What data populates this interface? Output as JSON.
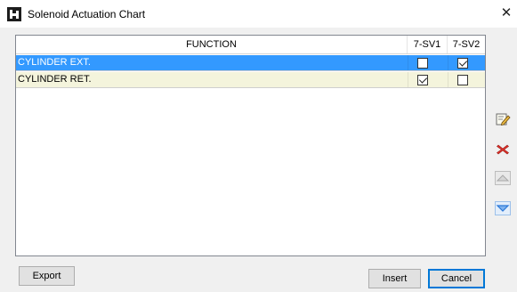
{
  "window": {
    "title": "Solenoid Actuation Chart",
    "close_glyph": "✕"
  },
  "grid": {
    "columns": [
      "FUNCTION",
      "7-SV1",
      "7-SV2"
    ],
    "rows": [
      {
        "function": "CYLINDER EXT.",
        "sv1": false,
        "sv2": true,
        "selected": true
      },
      {
        "function": "CYLINDER RET.",
        "sv1": true,
        "sv2": false,
        "selected": false
      }
    ]
  },
  "side_toolbar": {
    "items": [
      "edit-icon",
      "delete-icon",
      "move-up-icon",
      "move-down-icon"
    ]
  },
  "buttons": {
    "export": "Export",
    "insert": "Insert",
    "cancel": "Cancel"
  },
  "colors": {
    "selection": "#3399ff",
    "alt_row": "#f4f4dc",
    "delete": "#e0302a",
    "move_down": "#2b78d8"
  }
}
